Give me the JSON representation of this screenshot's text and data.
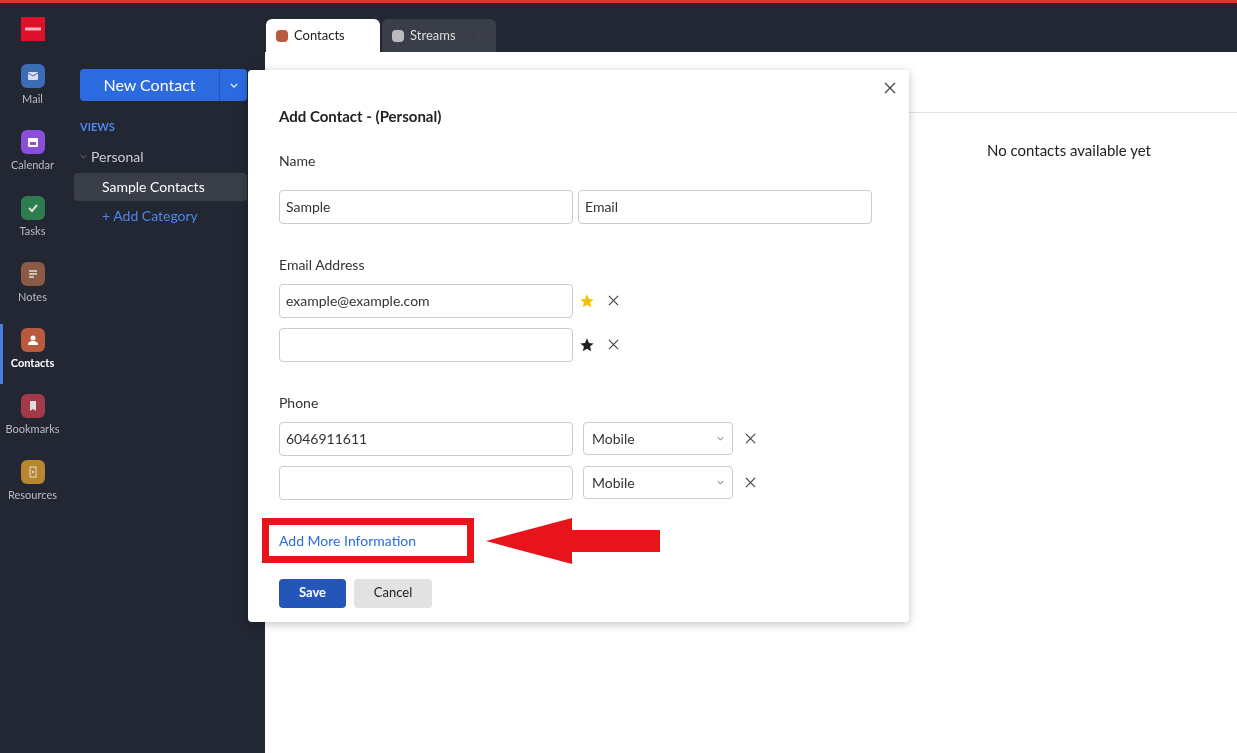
{
  "nav": [
    {
      "label": "Mail",
      "selected": false
    },
    {
      "label": "Calendar",
      "selected": false
    },
    {
      "label": "Tasks",
      "selected": false
    },
    {
      "label": "Notes",
      "selected": false
    },
    {
      "label": "Contacts",
      "selected": true
    },
    {
      "label": "Bookmarks",
      "selected": false
    },
    {
      "label": "Resources",
      "selected": false
    }
  ],
  "sidebar": {
    "new_button": "New Contact",
    "views_heading": "VIEWS",
    "group": {
      "label": "Personal",
      "expanded": true,
      "children": [
        {
          "label": "Sample Contacts",
          "selected": true
        }
      ]
    },
    "add_category": "+ Add Category"
  },
  "tabs": [
    {
      "label": "Contacts",
      "selected": true,
      "closable": false
    },
    {
      "label": "Streams",
      "selected": false,
      "closable": true
    }
  ],
  "empty_message": "No contacts available yet",
  "dialog": {
    "title": "Add Contact - (Personal)",
    "name_label": "Name",
    "first_name": {
      "value": "Sample"
    },
    "last_name": {
      "value": "Email"
    },
    "email_label": "Email Address",
    "emails": [
      {
        "value": "example@example.com",
        "primary": true
      },
      {
        "primary": false
      }
    ],
    "phone_label": "Phone",
    "phones": [
      {
        "value": "6046911611",
        "type": "Mobile"
      },
      {
        "type": "Mobile"
      }
    ],
    "more_link": "Add More Information",
    "save": "Save",
    "cancel": "Cancel"
  },
  "annotation": {
    "highlight": true
  }
}
